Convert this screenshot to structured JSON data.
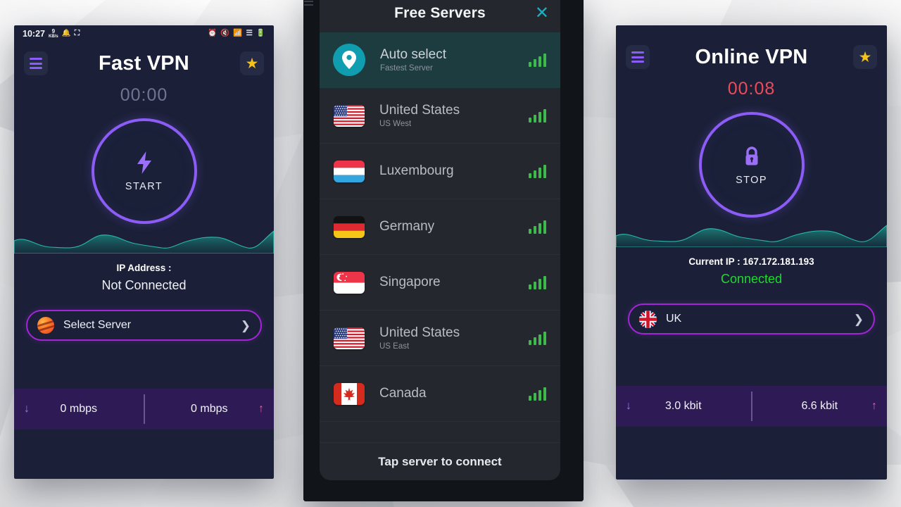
{
  "theme": {
    "panel_bg": "#1b2038",
    "accent_purple": "#8b5cf6",
    "pill_border": "#a226d7",
    "connected_green": "#22d831",
    "timer_red": "#ee4a5a",
    "teal": "#19b0c4",
    "star_gold": "#f5c21b",
    "speedbar_bg": "#2e1b56"
  },
  "left_phone": {
    "statusbar": {
      "time": "10:27",
      "data_rate_value": "9",
      "data_rate_unit": "KB/s",
      "left_icons": [
        "data-rate-icon",
        "notification-bell-icon",
        "screenshot-icon"
      ],
      "right_icons": [
        "alarm-clock-icon",
        "mute-icon",
        "wifi-icon",
        "signal-bars-icon",
        "battery-icon"
      ]
    },
    "header": {
      "title": "Fast VPN",
      "menu_icon": "hamburger-menu-icon",
      "favorite_icon": "star-icon"
    },
    "timer": "00:00",
    "power": {
      "label": "START",
      "icon": "lightning-bolt-icon",
      "state": "disconnected"
    },
    "info": {
      "ip_label": "IP Address :",
      "ip_value": "Not Connected",
      "connected": false
    },
    "server_pill": {
      "label": "Select Server",
      "icon": "globe-icon",
      "chevron": "chevron-right-icon"
    },
    "speed": {
      "download": "0 mbps",
      "upload": "0 mbps",
      "down_icon": "arrow-down-icon",
      "up_icon": "arrow-up-icon"
    }
  },
  "middle_phone": {
    "sheet": {
      "title": "Free Servers",
      "close_icon": "close-icon",
      "footer": "Tap server to connect",
      "servers": [
        {
          "name": "Auto select",
          "sub": "Fastest Server",
          "icon": "location-pin-icon",
          "selected": true,
          "signal": 4
        },
        {
          "name": "United States",
          "sub": "US West",
          "flag": "us",
          "selected": false,
          "signal": 4
        },
        {
          "name": "Luxembourg",
          "sub": "",
          "flag": "lu",
          "selected": false,
          "signal": 4
        },
        {
          "name": "Germany",
          "sub": "",
          "flag": "de",
          "selected": false,
          "signal": 4
        },
        {
          "name": "Singapore",
          "sub": "",
          "flag": "sg",
          "selected": false,
          "signal": 4
        },
        {
          "name": "United States",
          "sub": "US East",
          "flag": "us",
          "selected": false,
          "signal": 4
        },
        {
          "name": "Canada",
          "sub": "",
          "flag": "ca",
          "selected": false,
          "signal": 4
        }
      ]
    }
  },
  "right_phone": {
    "header": {
      "title": "Online VPN",
      "menu_icon": "hamburger-menu-icon",
      "favorite_icon": "star-icon"
    },
    "timer": "00:08",
    "power": {
      "label": "STOP",
      "icon": "lock-icon",
      "state": "connected"
    },
    "info": {
      "ip_label": "Current IP : 167.172.181.193",
      "ip_value": "Connected",
      "connected": true
    },
    "server_pill": {
      "label": "UK",
      "icon": "uk-flag-icon",
      "chevron": "chevron-right-icon"
    },
    "speed": {
      "download": "3.0 kbit",
      "upload": "6.6 kbit",
      "down_icon": "arrow-down-icon",
      "up_icon": "arrow-up-icon"
    }
  }
}
